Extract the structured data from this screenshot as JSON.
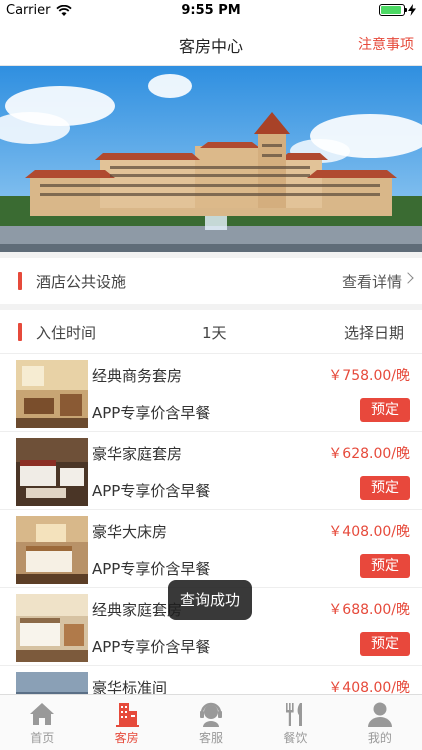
{
  "statusbar": {
    "carrier": "Carrier",
    "time": "9:55 PM",
    "battery_level": 0.92
  },
  "nav": {
    "title": "客房中心",
    "notice": "注意事项"
  },
  "facilities": {
    "label": "酒店公共设施",
    "link": "查看详情"
  },
  "checkin": {
    "label": "入住时间",
    "days": "1天",
    "select": "选择日期"
  },
  "rooms": [
    {
      "name": "经典商务套房",
      "price": "￥758.00/晚",
      "note": "APP专享价含早餐",
      "button": "预定"
    },
    {
      "name": "豪华家庭套房",
      "price": "￥628.00/晚",
      "note": "APP专享价含早餐",
      "button": "预定"
    },
    {
      "name": "豪华大床房",
      "price": "￥408.00/晚",
      "note": "APP专享价含早餐",
      "button": "预定"
    },
    {
      "name": "经典家庭套房",
      "price": "￥688.00/晚",
      "note": "APP专享价含早餐",
      "button": "预定"
    },
    {
      "name": "豪华标准间",
      "price": "￥408.00/晚"
    }
  ],
  "toast": "查询成功",
  "tabbar": {
    "items": [
      {
        "label": "首页",
        "icon": "home-icon",
        "active": false
      },
      {
        "label": "客房",
        "icon": "hotel-icon",
        "active": true
      },
      {
        "label": "客服",
        "icon": "service-icon",
        "active": false
      },
      {
        "label": "餐饮",
        "icon": "dining-icon",
        "active": false
      },
      {
        "label": "我的",
        "icon": "profile-icon",
        "active": false
      }
    ]
  },
  "colors": {
    "accent": "#e64a3b",
    "tab_inactive": "#999999"
  }
}
